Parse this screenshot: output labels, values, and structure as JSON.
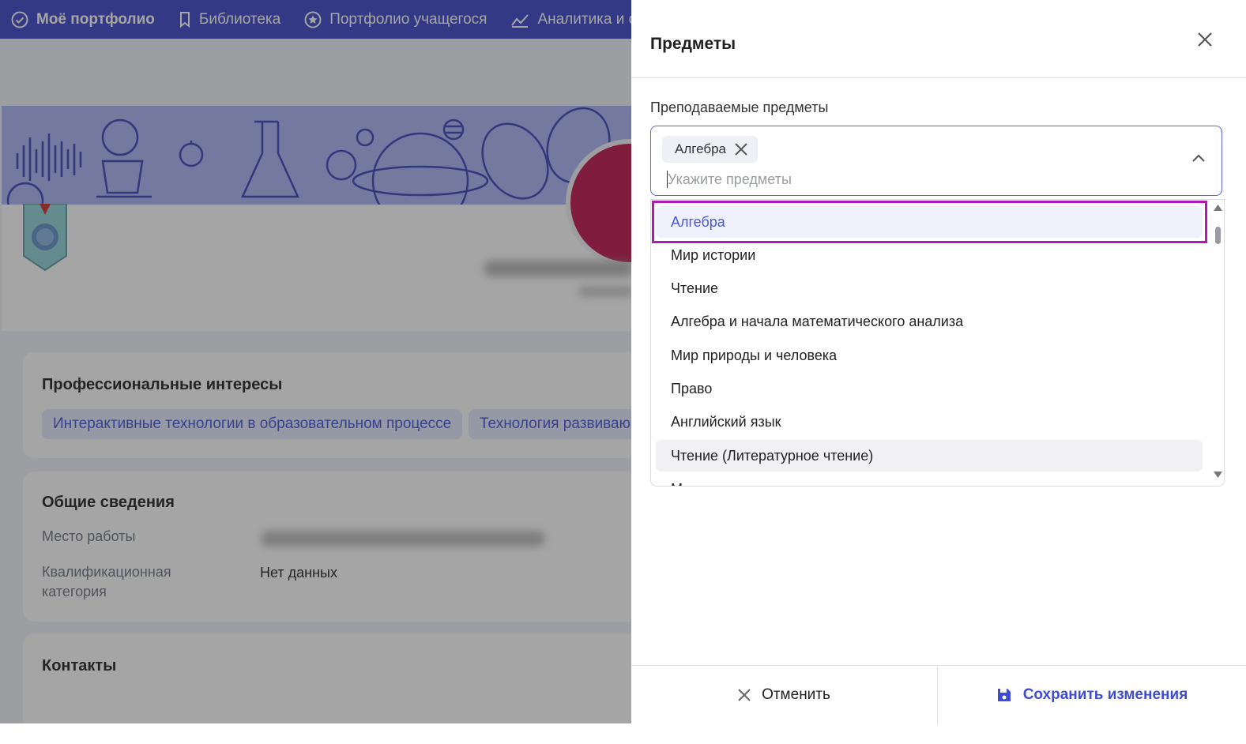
{
  "nav": {
    "items": [
      "Моё портфолио",
      "Библиотека",
      "Портфолио учащегося",
      "Аналитика и отч"
    ]
  },
  "profile": {
    "interests_title": "Профессиональные интересы",
    "interests": [
      "Интерактивные технологии в образовательном процессе",
      "Технология развиваю"
    ],
    "general_title": "Общие сведения",
    "workplace_label": "Место работы",
    "qualification_label": "Квалификационная категория",
    "qualification_value": "Нет данных",
    "contacts_title": "Контакты"
  },
  "drawer": {
    "title": "Предметы",
    "field_label": "Преподаваемые предметы",
    "selected_tag": "Алгебра",
    "search_placeholder": "Укажите предметы",
    "options": [
      "Алгебра",
      "Мир истории",
      "Чтение",
      "Алгебра и начала математического анализа",
      "Мир природы и человека",
      "Право",
      "Английский язык",
      "Чтение (Литературное чтение)",
      "М"
    ],
    "selected_option_index": 0,
    "hovered_option_index": 7,
    "cancel_label": "Отменить",
    "save_label": "Сохранить изменения"
  },
  "colors": {
    "nav_bg": "#3d46c9",
    "accent": "#4a58d8",
    "highlight_border": "#b516b8",
    "avatar": "#c0144e"
  }
}
